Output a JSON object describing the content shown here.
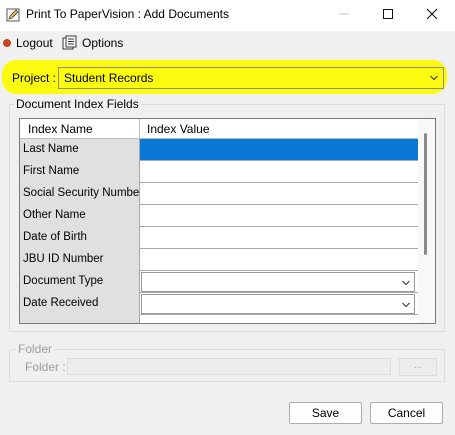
{
  "window": {
    "title": "Print To PaperVision : Add Documents",
    "icon": "pencil-icon",
    "controls": [
      "minimize-icon",
      "maximize-icon",
      "close-icon"
    ]
  },
  "menu": {
    "logout": {
      "label": "Logout",
      "icon": "logout-dot-icon",
      "icon_color": "#d0451b"
    },
    "options": {
      "label": "Options",
      "icon": "options-icon"
    }
  },
  "project": {
    "label": "Project :",
    "value": "Student Records",
    "highlight_color": "#fbfb0f"
  },
  "index_fields": {
    "group_label": "Document Index Fields",
    "columns": [
      "Index Name",
      "Index Value"
    ],
    "rows": [
      {
        "name": "Last Name",
        "value": "",
        "selected": true
      },
      {
        "name": "First Name",
        "value": ""
      },
      {
        "name": "Social Security Number",
        "value": ""
      },
      {
        "name": "Other Name",
        "value": ""
      },
      {
        "name": "Date of Birth",
        "value": ""
      },
      {
        "name": "JBU ID Number",
        "value": ""
      },
      {
        "name": "Document Type",
        "value": "",
        "dropdown": true
      },
      {
        "name": "Date Received",
        "value": "",
        "dropdown": true
      }
    ],
    "selected_color": "#0a78d7"
  },
  "folder": {
    "group_label": "Folder",
    "label": "Folder :",
    "value": "",
    "browse_label": "..."
  },
  "buttons": {
    "save": "Save",
    "cancel": "Cancel"
  }
}
